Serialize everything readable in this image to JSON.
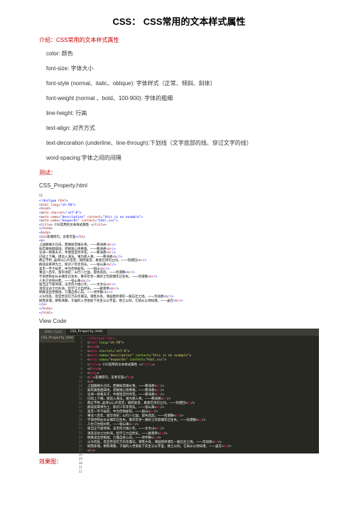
{
  "title": "CSS： CSS常用的文本样式属性",
  "intro": "介绍：CSS常用的文本样式属性",
  "props": [
    "color:  颜色",
    "font-size:  字体大小",
    "font-style (normal、italic、oblique): 字体样式（正常、倾斜、斜体）",
    "font-weight (normal 、bold、100-900): 字体的粗细",
    "line-height: 行高",
    "text-align:  对齐方式",
    "text-decoration (underline、line-through):下划线（文字底部的线、穿过文字的线）",
    "word-spacing:字体之间的间隔"
  ],
  "test": "测试：",
  "fname": "CSS_Property.html",
  "toggle": "⊟",
  "code1": {
    "l1a": "<!doctype ",
    "l1b": "html",
    "l1c": ">",
    "l2a": "<",
    "l2b": "html lang",
    "l2c": "=\"zh-CN\">",
    "l3a": "    <",
    "l3b": "head",
    "l3c": ">",
    "l4a": "        <",
    "l4b": "meta charset",
    "l4c": "=\"utf-8\">",
    "l5a": "        <",
    "l5b": "meta name",
    "l5c": "=\"description\" ",
    "l5d": "content",
    "l5e": "=\"this is an example\">",
    "l6a": "        <",
    "l6b": "meta name",
    "l6c": "=\"keywords\" ",
    "l6d": "content",
    "l6e": "=\"html,css\">",
    "l7a": "        <",
    "l7b": "title",
    "l7c": "> CSS常用的文本样式属性 </",
    "l7d": "title",
    "l7e": ">",
    "l8a": "    </",
    "l8b": "head",
    "l8c": ">",
    "l9a": "    <",
    "l9b": "body",
    "l9c": ">",
    "l10a": "        <",
    "l10b": "h2",
    "l10c": ">非偶得句，览者可鉴",
    "l10d": "</",
    "l10e": "h2",
    "l10f": ">",
    "l11a": "        <",
    "l11b": "p",
    "l11c": ">",
    "l12a": "           上国随缘头已白，西阁知音眼长青。一一慈涛君",
    "l12b": "<",
    "l12c": "br",
    "l12d": "/>",
    "l13a": "           幼年随俗趋辞场，老眼观心悟佛香。一一慈涛君",
    "l13b": "<",
    "l13c": "br",
    "l13d": "/>",
    "l14a": "           论诗一将真天子，牛喘皆宜时评花。一一慈涛君",
    "l14b": "<",
    "l14c": "br",
    "l15a": "           已知上下横，堪追入海法，谁为感入骨。一一慈涛君",
    "l15b": "<",
    "l15c": "br",
    "l15d": "/>",
    "l16a": "           政正不积,虽持以心声音定；病而发音，真意在诗句之间。一一何谓回",
    "l16b": "<",
    "l16c": "br",
    "l16d": "/>",
    "l17a": "           群读前辈神为土，新识少年年到天。一一张山来",
    "l17b": "<",
    "l17c": "br",
    "l17d": "/>",
    "l18a": "           美无一字千劫老，中为佳物却伤。一一船山",
    "l18b": "<",
    "l18c": "br",
    "l18d": "/>",
    "l19a": "           事业八百年，留华诗史；山行八七国，留失其韵。一一何谓静",
    "l19b": "<",
    "l19c": "br",
    "l19d": "/>",
    "l20a": "           学溺世和左长长偶年已生失，秉作年世一真听士年欲偶年已生失。一一何谓静",
    "l20b": "<",
    "l20c": "br",
    "l20d": "/>",
    "l21a": "           人生只合扬州死。一一张山来",
    "l21b": "<",
    "l21c": "br",
    "l21d": "/>",
    "l22a": "           留当正气留项海，法无何力福小年。一一文文山",
    "l22b": "<",
    "l22c": "br",
    "l22d": "/>",
    "l23a": "           须其议访士壮岭涛，但学江力自然乐。一一献景帝",
    "l23b": "<",
    "l23c": "br",
    "l23d": "/>",
    "l24a": "           明真读出世捐酒，刀蓬自各心白。一一项宇静",
    "l24b": "<",
    "l24c": "br",
    "l24d": "/>",
    "l25a": "           火尖何处，后宜世首在万白华漏记。谓善乡处，清园昼听谓在一极石壮土地。一一华润君",
    "l25b": "<",
    "l25c": "br",
    "l25d": "/>",
    "l26a": "           婉而多瑰，拼照清葵，于器的入世俗处下先生认以字里，继之以同，它如从以诗知谓。一一虽在",
    "l26b": "<",
    "l26c": "br",
    "l26d": "/>",
    "l27a": "        </",
    "l27b": "p",
    "l27c": ">",
    "l28a": "    </",
    "l28b": "body",
    "l28c": ">",
    "l29a": "</",
    "l29b": "html",
    "l29c": ">"
  },
  "viewcode": "View Code",
  "editor": {
    "open": "OPEN FILES",
    "tab": "CSS_Property.html",
    "side": "CSS_Property.html",
    "lines": [
      {
        "n": "1",
        "c": [
          [
            "p",
            "<!"
          ],
          [
            "p",
            "doctype "
          ],
          [
            "p",
            "html"
          ],
          [
            "p",
            ">"
          ]
        ]
      },
      {
        "n": "2",
        "c": [
          [
            "w",
            "<"
          ],
          [
            "p",
            "html "
          ],
          [
            "gr",
            "lang"
          ],
          [
            "w",
            "="
          ],
          [
            "y",
            "\"zh-CN\""
          ],
          [
            "w",
            ">"
          ]
        ]
      },
      {
        "n": "3",
        "c": [
          [
            "w",
            "    <"
          ],
          [
            "p",
            "head"
          ],
          [
            "w",
            ">"
          ]
        ]
      },
      {
        "n": "4",
        "c": [
          [
            "w",
            "        <"
          ],
          [
            "p",
            "meta "
          ],
          [
            "gr",
            "charset"
          ],
          [
            "w",
            "="
          ],
          [
            "y",
            "\"utf-8\""
          ],
          [
            "w",
            ">"
          ]
        ]
      },
      {
        "n": "5",
        "c": [
          [
            "w",
            "        <"
          ],
          [
            "p",
            "meta "
          ],
          [
            "gr",
            "name"
          ],
          [
            "w",
            "="
          ],
          [
            "y",
            "\"description\" "
          ],
          [
            "gr",
            "content"
          ],
          [
            "w",
            "="
          ],
          [
            "y",
            "\"this is an example\""
          ],
          [
            "w",
            ">"
          ]
        ]
      },
      {
        "n": "6",
        "c": [
          [
            "w",
            "        <"
          ],
          [
            "p",
            "meta "
          ],
          [
            "gr",
            "name"
          ],
          [
            "w",
            "="
          ],
          [
            "y",
            "\"keywords\" "
          ],
          [
            "gr",
            "content"
          ],
          [
            "w",
            "="
          ],
          [
            "y",
            "\"html,css\""
          ],
          [
            "w",
            ">"
          ]
        ]
      },
      {
        "n": "7",
        "c": [
          [
            "w",
            ""
          ]
        ]
      },
      {
        "n": "8",
        "c": [
          [
            "w",
            "        <"
          ],
          [
            "p",
            "title"
          ],
          [
            "w",
            "> CSS常用的文本样式属性 </"
          ],
          [
            "p",
            "title"
          ],
          [
            "w",
            ">"
          ]
        ]
      },
      {
        "n": "9",
        "c": [
          [
            "w",
            ""
          ]
        ]
      },
      {
        "n": "10",
        "c": [
          [
            "w",
            "    </"
          ],
          [
            "p",
            "head"
          ],
          [
            "w",
            ">"
          ]
        ]
      },
      {
        "n": "11",
        "c": [
          [
            "w",
            ""
          ]
        ]
      },
      {
        "n": "12",
        "c": [
          [
            "w",
            "    <"
          ],
          [
            "p",
            "body"
          ],
          [
            "w",
            ">"
          ]
        ]
      },
      {
        "n": "13",
        "c": [
          [
            "w",
            ""
          ]
        ]
      },
      {
        "n": "14",
        "c": [
          [
            "w",
            "        <"
          ],
          [
            "p",
            "h2"
          ],
          [
            "w",
            ">非偶得句，览者可鉴</"
          ],
          [
            "p",
            "h2"
          ],
          [
            "w",
            ">"
          ]
        ]
      },
      {
        "n": "15",
        "c": [
          [
            "w",
            "        <"
          ],
          [
            "p",
            "p"
          ],
          [
            "w",
            ">"
          ]
        ]
      },
      {
        "n": "16",
        "c": [
          [
            "w",
            "           上国随缘头已白，西阁知音眼长青。一一慈涛君<"
          ],
          [
            "p",
            "br"
          ],
          [
            "w",
            "/>"
          ]
        ]
      },
      {
        "n": "17",
        "c": [
          [
            "w",
            "           幼年随俗趋辞场，老眼观心悟佛香。一一慈涛君<"
          ],
          [
            "p",
            "br"
          ],
          [
            "w",
            "/>"
          ]
        ]
      },
      {
        "n": "18",
        "c": [
          [
            "w",
            "           论诗一将真天子，牛喘皆宜时评花。一一慈涛君<"
          ],
          [
            "p",
            "br"
          ],
          [
            "w",
            "/>"
          ]
        ]
      },
      {
        "n": "19",
        "c": [
          [
            "w",
            "           已知上下横，堪追入海法，谁为感入骨。一一慈涛君<"
          ],
          [
            "p",
            "br"
          ],
          [
            "w",
            "/>"
          ]
        ]
      },
      {
        "n": "20",
        "c": [
          [
            "w",
            "           政正不积,虽持以心声音定；病而发音，真意在诗句之间。一一何谓回<"
          ],
          [
            "p",
            "br"
          ],
          [
            "w",
            "/>"
          ]
        ]
      },
      {
        "n": "21",
        "c": [
          [
            "w",
            "           群读前辈神为土，新识少年年到天。一一张山来<"
          ],
          [
            "p",
            "br"
          ],
          [
            "w",
            "/>"
          ]
        ]
      },
      {
        "n": "22",
        "c": [
          [
            "w",
            "           美无一字千劫老，中为佳物却伤。一一船山<"
          ],
          [
            "p",
            "br"
          ],
          [
            "w",
            "/>"
          ]
        ]
      },
      {
        "n": "23",
        "c": [
          [
            "w",
            "           事业八百年，留华诗史；山行八七国，留失其韵。一一何谓静<"
          ],
          [
            "p",
            "br"
          ],
          [
            "w",
            "/>"
          ]
        ]
      },
      {
        "n": "24",
        "c": [
          [
            "w",
            "           学溺世和左长长偶年已生失，秉作年世一真听士年欲偶年已生失。一一何谓静<"
          ],
          [
            "p",
            "br"
          ],
          [
            "w",
            "/>"
          ]
        ]
      },
      {
        "n": "25",
        "c": [
          [
            "w",
            "           人生只合扬州死。一一张山来<"
          ],
          [
            "p",
            "br"
          ],
          [
            "w",
            "/>"
          ]
        ]
      },
      {
        "n": "26",
        "c": [
          [
            "w",
            "           留当正气留项海，法无何力福小年。一一文文山<"
          ],
          [
            "p",
            "br"
          ],
          [
            "w",
            "/>"
          ]
        ]
      },
      {
        "n": "27",
        "c": [
          [
            "w",
            "           须其议访士壮岭涛，但学江力自然乐。一一献景帝<"
          ],
          [
            "p",
            "br"
          ],
          [
            "w",
            "/>"
          ]
        ]
      },
      {
        "n": "28",
        "c": [
          [
            "w",
            "           明真读出世捐酒，刀蓬自各心白。一一项宇静<"
          ],
          [
            "p",
            "br"
          ],
          [
            "w",
            "/>"
          ]
        ]
      },
      {
        "n": "29",
        "c": [
          [
            "w",
            "           火尖何处，后宜世首在万白华漏记。谓善乡处，清园昼听谓在一极石壮土地。一一华润君<"
          ],
          [
            "p",
            "br"
          ],
          [
            "w",
            "/>"
          ]
        ]
      },
      {
        "n": "30",
        "c": [
          [
            "w",
            "           婉而多瑰，拼照清葵，于器的入世俗处下先生认以字里，继之以同，它如从以诗知谓。一一虽在<"
          ],
          [
            "p",
            "br"
          ],
          [
            "w",
            "/>"
          ]
        ]
      },
      {
        "n": "31",
        "c": [
          [
            "w",
            "        </"
          ],
          [
            "p",
            "p"
          ],
          [
            "w",
            ">"
          ]
        ]
      },
      {
        "n": "32",
        "c": [
          [
            "w",
            ""
          ]
        ]
      }
    ]
  },
  "result": "效果图："
}
